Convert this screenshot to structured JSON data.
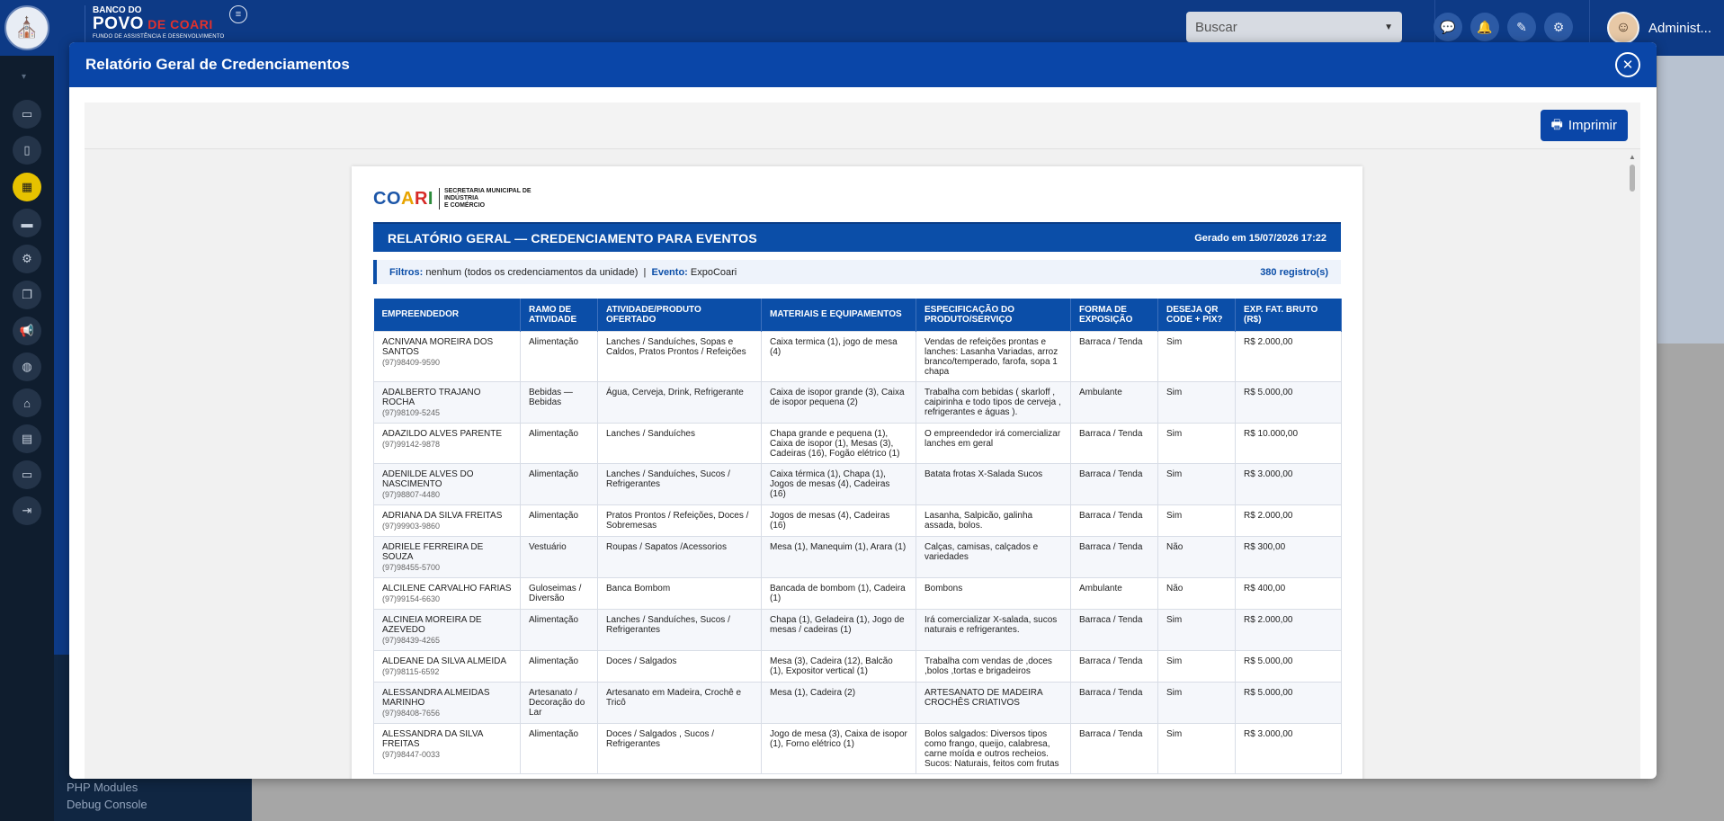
{
  "brand": {
    "line1": "BANCO DO",
    "line2a": "POVO",
    "line2b": " DE COARI",
    "line3": "FUNDO DE ASSISTÊNCIA E DESENVOLVIMENTO"
  },
  "search": {
    "placeholder": "Buscar"
  },
  "user": {
    "name": "Administ..."
  },
  "modal": {
    "title": "Relatório Geral de Credenciamentos",
    "print_label": "Imprimir"
  },
  "doc": {
    "logo_main": [
      "CO",
      "A",
      "R",
      "I"
    ],
    "logo_side": [
      "SECRETARIA MUNICIPAL DE",
      "INDÚSTRIA",
      "E COMÉRCIO"
    ],
    "title": "RELATÓRIO GERAL — CREDENCIAMENTO PARA EVENTOS",
    "generated": "Gerado em 15/07/2026 17:22",
    "filters_label": "Filtros:",
    "filters_value": "nenhum (todos os credenciamentos da unidade)",
    "event_label": "Evento:",
    "event_value": "ExpoCoari",
    "count": "380 registro(s)"
  },
  "sidebar": {
    "links": [
      "PHP Modules",
      "Debug Console"
    ]
  },
  "table": {
    "headers": [
      "Empreendedor",
      "Ramo de Atividade",
      "Atividade/Produto Ofertado",
      "Materiais e Equipamentos",
      "Especificação do Produto/Serviço",
      "Forma de Exposição",
      "Deseja QR Code + PIX?",
      "Exp. Fat. Bruto (R$)"
    ],
    "rows": [
      {
        "name": "ACNIVANA MOREIRA DOS SANTOS",
        "phone": "(97)98409-9590",
        "ramo": "Alimentação",
        "atividade": "Lanches / Sanduíches, Sopas e Caldos, Pratos Prontos / Refeições",
        "materiais": "Caixa termica (1), jogo de mesa (4)",
        "espec": "Vendas de refeições prontas e lanches: Lasanha Variadas, arroz branco/temperado, farofa, sopa 1 chapa",
        "forma": "Barraca / Tenda",
        "qr": "Sim",
        "fat": "R$ 2.000,00"
      },
      {
        "name": "ADALBERTO TRAJANO ROCHA",
        "phone": "(97)98109-5245",
        "ramo": "Bebidas — Bebidas",
        "atividade": "Água, Cerveja, Drink, Refrigerante",
        "materiais": "Caixa de isopor grande (3), Caixa de isopor pequena (2)",
        "espec": "Trabalha com bebidas ( skarloff , caipirinha e todo tipos de cerveja , refrigerantes e águas ).",
        "forma": "Ambulante",
        "qr": "Sim",
        "fat": "R$ 5.000,00"
      },
      {
        "name": "ADAZILDO ALVES PARENTE",
        "phone": "(97)99142-9878",
        "ramo": "Alimentação",
        "atividade": "Lanches / Sanduíches",
        "materiais": "Chapa grande e pequena (1), Caixa de isopor (1), Mesas (3), Cadeiras (16), Fogão elétrico (1)",
        "espec": "O empreendedor irá comercializar lanches em geral",
        "forma": "Barraca / Tenda",
        "qr": "Sim",
        "fat": "R$ 10.000,00"
      },
      {
        "name": "ADENILDE ALVES DO NASCIMENTO",
        "phone": "(97)98807-4480",
        "ramo": "Alimentação",
        "atividade": "Lanches / Sanduíches, Sucos / Refrigerantes",
        "materiais": "Caixa térmica (1), Chapa (1), Jogos de mesas (4), Cadeiras (16)",
        "espec": "Batata frotas X-Salada Sucos",
        "forma": "Barraca / Tenda",
        "qr": "Sim",
        "fat": "R$ 3.000,00"
      },
      {
        "name": "ADRIANA DA SILVA FREITAS",
        "phone": "(97)99903-9860",
        "ramo": "Alimentação",
        "atividade": "Pratos Prontos / Refeições, Doces / Sobremesas",
        "materiais": "Jogos de mesas (4), Cadeiras (16)",
        "espec": "Lasanha, Salpicão, galinha assada, bolos.",
        "forma": "Barraca / Tenda",
        "qr": "Sim",
        "fat": "R$ 2.000,00"
      },
      {
        "name": "ADRIELE FERREIRA DE SOUZA",
        "phone": "(97)98455-5700",
        "ramo": "Vestuário",
        "atividade": "Roupas / Sapatos /Acessorios",
        "materiais": "Mesa (1), Manequim (1), Arara (1)",
        "espec": "Calças, camisas, calçados e variedades",
        "forma": "Barraca / Tenda",
        "qr": "Não",
        "fat": "R$ 300,00"
      },
      {
        "name": "ALCILENE CARVALHO FARIAS",
        "phone": "(97)99154-6630",
        "ramo": "Guloseimas / Diversão",
        "atividade": "Banca Bombom",
        "materiais": "Bancada de bombom (1), Cadeira (1)",
        "espec": "Bombons",
        "forma": "Ambulante",
        "qr": "Não",
        "fat": "R$ 400,00"
      },
      {
        "name": "ALCINEIA MOREIRA DE AZEVEDO",
        "phone": "(97)98439-4265",
        "ramo": "Alimentação",
        "atividade": "Lanches / Sanduíches, Sucos / Refrigerantes",
        "materiais": "Chapa (1), Geladeira (1), Jogo de mesas / cadeiras (1)",
        "espec": "Irá comercializar X-salada, sucos naturais e refrigerantes.",
        "forma": "Barraca / Tenda",
        "qr": "Sim",
        "fat": "R$ 2.000,00"
      },
      {
        "name": "ALDEANE DA SILVA ALMEIDA",
        "phone": "(97)98115-6592",
        "ramo": "Alimentação",
        "atividade": "Doces / Salgados",
        "materiais": "Mesa (3), Cadeira (12), Balcão (1), Expositor vertical (1)",
        "espec": "Trabalha com vendas de ,doces ,bolos ,tortas e brigadeiros",
        "forma": "Barraca / Tenda",
        "qr": "Sim",
        "fat": "R$ 5.000,00"
      },
      {
        "name": "ALESSANDRA ALMEIDAS MARINHO",
        "phone": "(97)98408-7656",
        "ramo": "Artesanato / Decoração do Lar",
        "atividade": "Artesanato em Madeira, Crochê e Tricô",
        "materiais": "Mesa (1), Cadeira (2)",
        "espec": "ARTESANATO DE MADEIRA CROCHÊS CRIATIVOS",
        "forma": "Barraca / Tenda",
        "qr": "Sim",
        "fat": "R$ 5.000,00"
      },
      {
        "name": "ALESSANDRA DA SILVA FREITAS",
        "phone": "(97)98447-0033",
        "ramo": "Alimentação",
        "atividade": "Doces / Salgados , Sucos / Refrigerantes",
        "materiais": "Jogo de mesa (3), Caixa de isopor (1), Forno elétrico (1)",
        "espec": "Bolos salgados: Diversos tipos como frango, queijo, calabresa, carne moída e outros recheios. Sucos: Naturais, feitos com frutas",
        "forma": "Barraca / Tenda",
        "qr": "Sim",
        "fat": "R$ 3.000,00"
      }
    ]
  }
}
